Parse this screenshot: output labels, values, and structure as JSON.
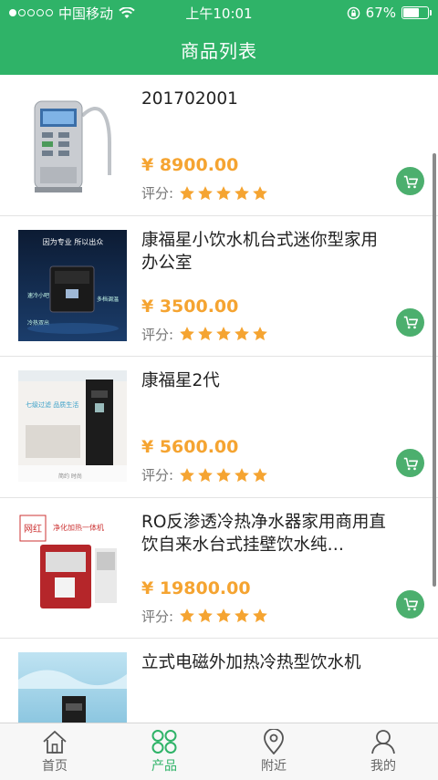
{
  "status_bar": {
    "carrier": "中国移动",
    "time": "上午10:01",
    "battery": "67%",
    "battery_level": 0.67
  },
  "header": {
    "title": "商品列表"
  },
  "products": [
    {
      "name": "201702001",
      "price": "¥ 8900.00",
      "rating_label": "评分:",
      "stars": 5
    },
    {
      "name": "康福星小饮水机台式迷你型家用办公室",
      "price": "¥ 3500.00",
      "rating_label": "评分:",
      "stars": 5,
      "image_text": [
        "因为专业 所以出众",
        "速冷小吧",
        "多档调温",
        "冷热双出"
      ]
    },
    {
      "name": "康福星2代",
      "price": "¥ 5600.00",
      "rating_label": "评分:",
      "stars": 5,
      "image_text": [
        "七级过滤 品质生活",
        "简约 时尚"
      ]
    },
    {
      "name": "RO反渗透冷热净水器家用商用直饮自来水台式挂壁饮水纯…",
      "price": "¥ 19800.00",
      "rating_label": "评分:",
      "stars": 5,
      "image_text": [
        "网红",
        "净化加热一体机"
      ]
    },
    {
      "name": "立式电磁外加热冷热型饮水机",
      "price": "",
      "rating_label": "",
      "stars": 0
    }
  ],
  "tabbar": {
    "tabs": [
      {
        "label": "首页",
        "icon": "home-icon"
      },
      {
        "label": "产品",
        "icon": "grid-icon",
        "active": true
      },
      {
        "label": "附近",
        "icon": "location-pin-icon"
      },
      {
        "label": "我的",
        "icon": "person-icon"
      }
    ]
  },
  "colors": {
    "primary": "#2fb368",
    "price": "#f5a431",
    "star": "#f5a431",
    "cart": "#4caf6e"
  }
}
